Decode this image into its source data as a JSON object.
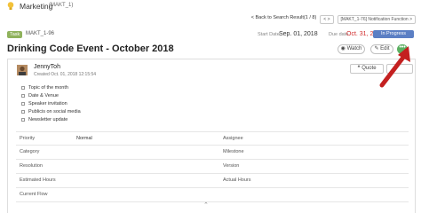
{
  "header": {
    "project_name": "Marketing",
    "project_key": "(MAKT_1)"
  },
  "nav": {
    "back_link": "< Back to Search Result(1 / 8)",
    "prev_next": "< >",
    "notification_function": "[MAKT_1-76] Notification Function >"
  },
  "issue": {
    "type": "Task",
    "key": "MAKT_1-96",
    "start_label": "Start Date",
    "start_date": "Sep. 01, 2018",
    "due_label": "Due date",
    "due_date": "Oct. 31, 2018",
    "status": "In Progress",
    "summary": "Drinking Code Event - October 2018",
    "watch_label": "Watch",
    "edit_label": "Edit",
    "more_label": "•••"
  },
  "comment": {
    "author": "JennyToh",
    "created": "Created Oct. 01, 2018 12:15:54",
    "quote_label": "Quote",
    "checklist": [
      "Topic of the month",
      "Date & Venue",
      "Speaker invitation",
      "Publicis on social media",
      "Newsletter update"
    ]
  },
  "fields": {
    "left": [
      {
        "label": "Priority",
        "value": "Normal"
      },
      {
        "label": "Category",
        "value": ""
      },
      {
        "label": "Resolution",
        "value": ""
      },
      {
        "label": "Estimated Hours",
        "value": ""
      },
      {
        "label": "Current Flow",
        "value": ""
      }
    ],
    "right": [
      {
        "label": "Assignee"
      },
      {
        "label": "Milestone"
      },
      {
        "label": "Version"
      },
      {
        "label": "Actual Hours"
      }
    ]
  },
  "colors": {
    "accent_status": "#5b7fc4",
    "type_badge": "#8fb25c",
    "due_date": "#d12a2a",
    "more_button": "#5bb061",
    "annotation_arrow": "#c42020"
  },
  "icons": {
    "bulb": "lightbulb-icon",
    "watch": "eye-icon",
    "edit": "pencil-icon",
    "more": "ellipsis-icon",
    "quote": "quote-icon",
    "collapse": "chevron-up-icon"
  }
}
